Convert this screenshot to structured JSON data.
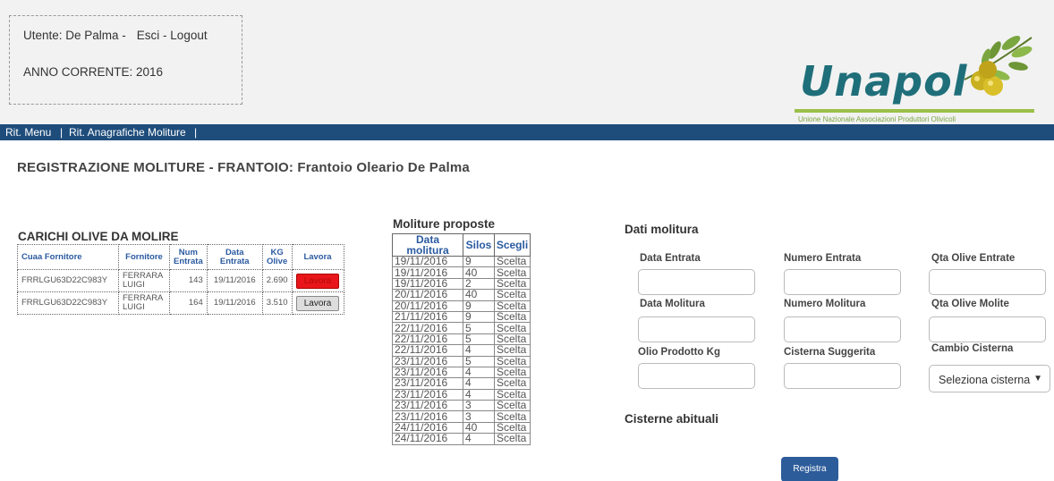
{
  "header": {
    "user_label": "Utente: De Palma -",
    "logout_label": "Esci - Logout",
    "year_label": "ANNO CORRENTE: 2016"
  },
  "logo": {
    "name": "Unapol",
    "subtitle": "Unione Nazionale Associazioni Produttori Olivicoli",
    "icon": "olive-branch-icon"
  },
  "nav": {
    "item1": "Rit. Menu",
    "sep1": "|",
    "item2": "Rit. Anagrafiche Moliture",
    "sep2": "|"
  },
  "page_title": "REGISTRAZIONE MOLITURE - FRANTOIO: Frantoio Oleario De Palma",
  "carichi": {
    "title": "CARICHI OLIVE DA MOLIRE",
    "headers": [
      "Cuaa Fornitore",
      "Fornitore",
      "Num Entrata",
      "Data Entrata",
      "KG Olive",
      "Lavora"
    ],
    "rows": [
      {
        "cuaa": "FRRLGU63D22C983Y",
        "fornitore": "FERRARA LUIGI",
        "num": "143",
        "data": "19/11/2016",
        "kg": "2.690",
        "btn": "Lavora",
        "active": true
      },
      {
        "cuaa": "FRRLGU63D22C983Y",
        "fornitore": "FERRARA LUIGI",
        "num": "164",
        "data": "19/11/2016",
        "kg": "3.510",
        "btn": "Lavora",
        "active": false
      }
    ]
  },
  "proposte": {
    "title": "Moliture proposte",
    "headers": [
      "Data molitura",
      "Silos",
      "Scegli"
    ],
    "rows": [
      [
        "19/11/2016",
        "9",
        "Scelta"
      ],
      [
        "19/11/2016",
        "40",
        "Scelta"
      ],
      [
        "19/11/2016",
        "2",
        "Scelta"
      ],
      [
        "20/11/2016",
        "40",
        "Scelta"
      ],
      [
        "20/11/2016",
        "9",
        "Scelta"
      ],
      [
        "21/11/2016",
        "9",
        "Scelta"
      ],
      [
        "22/11/2016",
        "5",
        "Scelta"
      ],
      [
        "22/11/2016",
        "5",
        "Scelta"
      ],
      [
        "22/11/2016",
        "4",
        "Scelta"
      ],
      [
        "23/11/2016",
        "5",
        "Scelta"
      ],
      [
        "23/11/2016",
        "4",
        "Scelta"
      ],
      [
        "23/11/2016",
        "4",
        "Scelta"
      ],
      [
        "23/11/2016",
        "4",
        "Scelta"
      ],
      [
        "23/11/2016",
        "3",
        "Scelta"
      ],
      [
        "23/11/2016",
        "3",
        "Scelta"
      ],
      [
        "24/11/2016",
        "40",
        "Scelta"
      ],
      [
        "24/11/2016",
        "4",
        "Scelta"
      ]
    ]
  },
  "dati": {
    "title": "Dati molitura",
    "data_entrata": "Data Entrata",
    "numero_entrata": "Numero Entrata",
    "qta_entrate": "Qta Olive Entrate",
    "data_molitura": "Data Molitura",
    "numero_molitura": "Numero Molitura",
    "qta_molite": "Qta Olive Molite",
    "olio_prodotto": "Olio Prodotto Kg",
    "cisterna_suggerita": "Cisterna Suggerita",
    "cambio_cisterna": "Cambio Cisterna",
    "select_value": "Seleziona cisterna",
    "cisterne_title": "Cisterne abituali",
    "registra_label": "Registra"
  },
  "colors": {
    "navbar": "#1e4d7b",
    "header_text": "#2a5aa0",
    "button_active": "#e8161a",
    "registra": "#2d5c9a",
    "logo_green": "#7aa640",
    "logo_teal": "#1f6f7a"
  }
}
